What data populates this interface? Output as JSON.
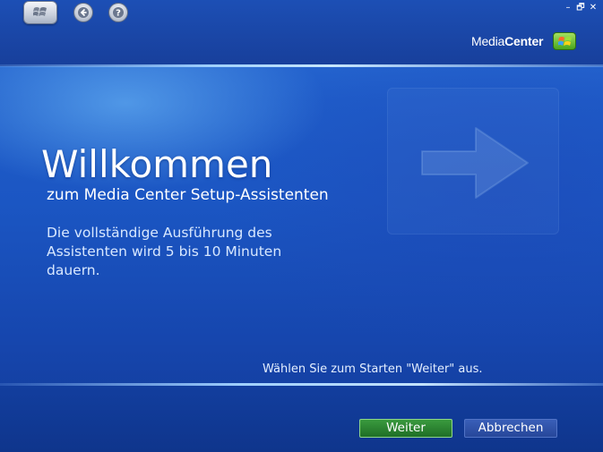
{
  "window": {
    "controls": {
      "minimize": "–",
      "restore": "🗗",
      "close": "✕"
    },
    "logo": {
      "light": "Media",
      "bold": "Center"
    }
  },
  "content": {
    "title": "Willkommen",
    "subtitle": "zum Media Center Setup-Assistenten",
    "description": "Die vollständige Ausführung des Assistenten wird 5 bis 10 Minuten dauern.",
    "hint": "Wählen Sie zum Starten \"Weiter\" aus."
  },
  "buttons": {
    "next": "Weiter",
    "cancel": "Abbrechen"
  },
  "colors": {
    "next_button": "#2a8a32",
    "cancel_button": "#3355aa",
    "accent_line": "#9fd0ff"
  },
  "icons": {
    "start": "windows-flag-icon",
    "back": "back-arrow-icon",
    "help": "help-icon",
    "watermark": "arrow-right-icon"
  }
}
